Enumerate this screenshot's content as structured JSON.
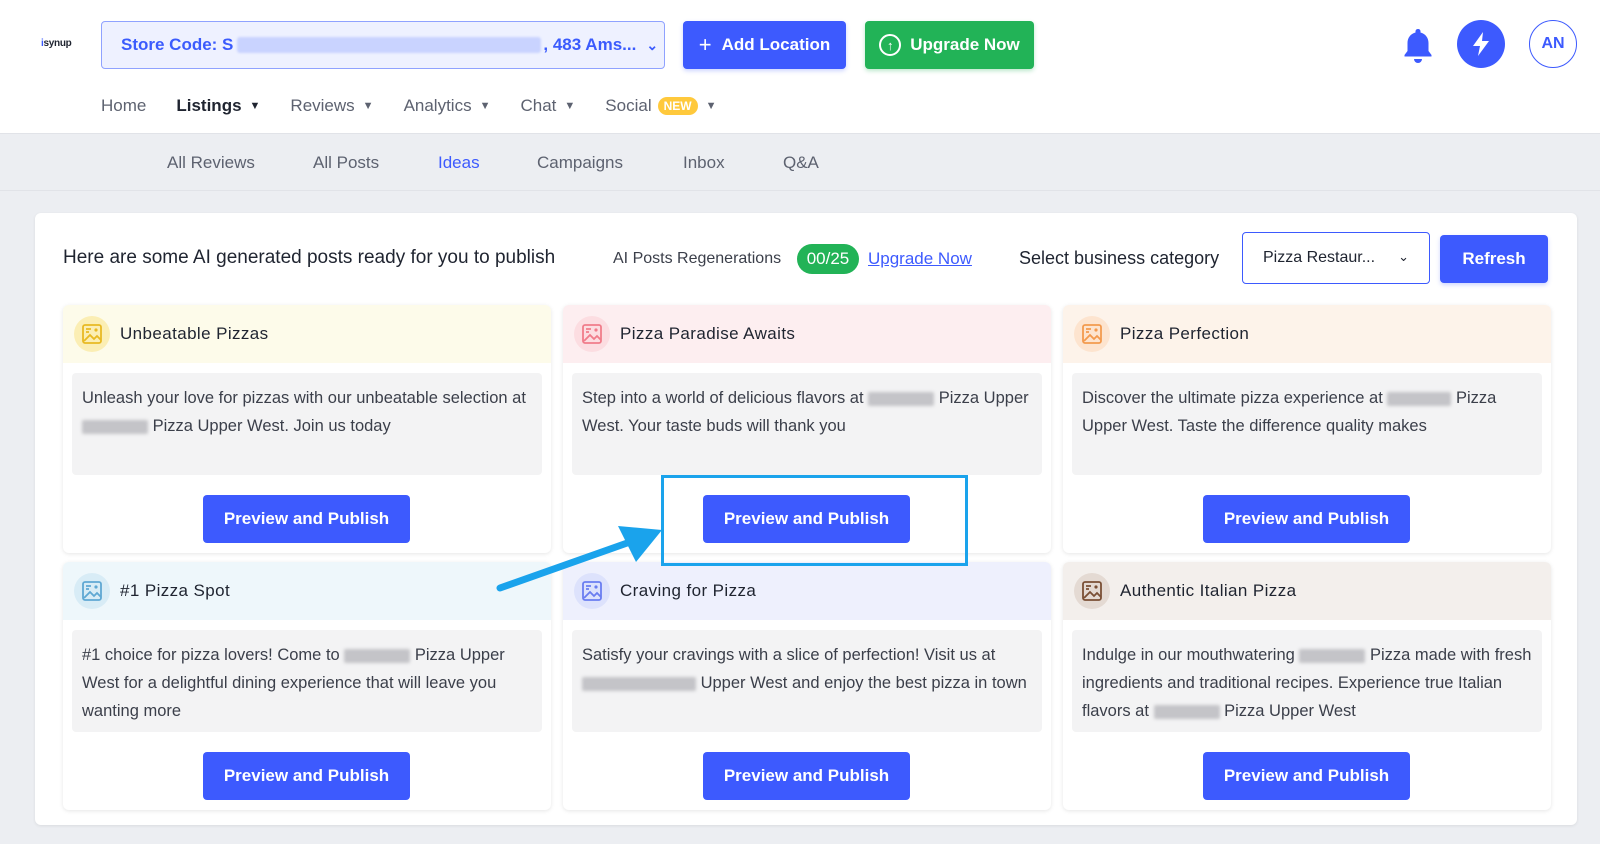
{
  "header": {
    "logo_text": "synup",
    "store_select": {
      "prefix": "Store Code: S",
      "suffix": ", 483 Ams..."
    },
    "add_location_label": "Add Location",
    "upgrade_label": "Upgrade Now",
    "avatar_initials": "AN"
  },
  "main_nav": [
    {
      "label": "Home",
      "active": false,
      "caret": false
    },
    {
      "label": "Listings",
      "active": true,
      "caret": true
    },
    {
      "label": "Reviews",
      "active": false,
      "caret": true
    },
    {
      "label": "Analytics",
      "active": false,
      "caret": true
    },
    {
      "label": "Chat",
      "active": false,
      "caret": true
    },
    {
      "label": "Social",
      "active": false,
      "caret": true,
      "badge": "NEW"
    }
  ],
  "sub_nav": [
    {
      "label": "All Reviews",
      "active": false
    },
    {
      "label": "All Posts",
      "active": false
    },
    {
      "label": "Ideas",
      "active": true
    },
    {
      "label": "Campaigns",
      "active": false
    },
    {
      "label": "Inbox",
      "active": false
    },
    {
      "label": "Q&A",
      "active": false
    }
  ],
  "panel": {
    "heading": "Here are some AI generated posts ready for you to publish",
    "regen_label": "AI Posts Regenerations",
    "regen_count": "00/25",
    "upgrade_link": "Upgrade Now",
    "category_label": "Select business category",
    "category_value": "Pizza Restaur...",
    "refresh_label": "Refresh"
  },
  "cards": [
    {
      "title": "Unbeatable Pizzas",
      "head_bg": "#fdfbea",
      "icon_bg": "#fbeeb4",
      "icon_color": "#e8b923",
      "text_a": "Unleash your love for pizzas with our unbeatable selection at ",
      "text_b": " Pizza Upper West. Join us today",
      "button": "Preview and Publish"
    },
    {
      "title": "Pizza Paradise Awaits",
      "head_bg": "#fdeef0",
      "icon_bg": "#fcdde1",
      "icon_color": "#f07c8a",
      "text_a": "Step into a world of delicious flavors at ",
      "text_b": " Pizza Upper West. Your taste buds will thank you",
      "button": "Preview and Publish"
    },
    {
      "title": "Pizza Perfection",
      "head_bg": "#fdf3ea",
      "icon_bg": "#fde4cf",
      "icon_color": "#f39a4e",
      "text_a": "Discover the ultimate pizza experience at ",
      "text_b": " Pizza Upper West. Taste the difference quality makes",
      "button": "Preview and Publish"
    },
    {
      "title": "#1 Pizza Spot",
      "head_bg": "#eef7fb",
      "icon_bg": "#d8ecf6",
      "icon_color": "#5fa8d3",
      "text_a": "#1 choice for pizza lovers! Come to ",
      "text_b": " Pizza Upper West for a delightful dining experience that will leave you wanting more",
      "button": "Preview and Publish"
    },
    {
      "title": "Craving for Pizza",
      "head_bg": "#eef0fd",
      "icon_bg": "#dde2fc",
      "icon_color": "#6a7df0",
      "text_a": "Satisfy your cravings with a slice of perfection! Visit us at ",
      "text_b": " Upper West and enjoy the best pizza in town",
      "button": "Preview and Publish"
    },
    {
      "title": "Authentic Italian Pizza",
      "head_bg": "#f3efec",
      "icon_bg": "#e4dad3",
      "icon_color": "#7a4f35",
      "text_a": "Indulge in our mouthwatering ",
      "text_b": " Pizza made with fresh ingredients and traditional recipes. Experience true Italian flavors at ",
      "text_c": " Pizza Upper West",
      "button": "Preview and Publish"
    }
  ]
}
